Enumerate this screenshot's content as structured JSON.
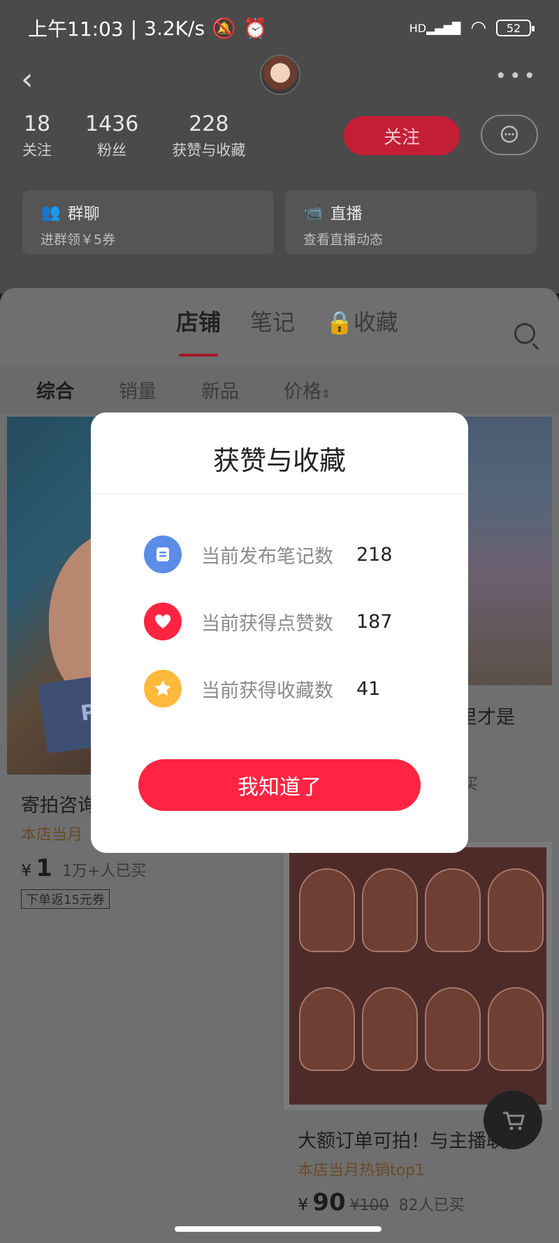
{
  "status_bar": {
    "time": "上午11:03",
    "speed": "3.2K/s",
    "battery": "52"
  },
  "profile": {
    "stats": [
      {
        "num": "18",
        "label": "关注"
      },
      {
        "num": "1436",
        "label": "粉丝"
      },
      {
        "num": "228",
        "label": "获赞与收藏"
      }
    ],
    "follow_label": "关注",
    "cards": [
      {
        "title": "群聊",
        "subtitle": "进群领￥5券",
        "icon": "group-icon"
      },
      {
        "title": "直播",
        "subtitle": "查看直播动态",
        "icon": "live-camera-icon"
      }
    ]
  },
  "tabs": [
    {
      "label": "店铺",
      "active": true
    },
    {
      "label": "笔记",
      "active": false
    },
    {
      "label": "收藏",
      "active": false,
      "icon": "lock-icon"
    }
  ],
  "filters": [
    {
      "label": "综合",
      "active": true
    },
    {
      "label": "销量",
      "active": false
    },
    {
      "label": "新品",
      "active": false
    },
    {
      "label": "价格",
      "active": false
    }
  ],
  "products": [
    {
      "title": "寄拍咨询",
      "tag": "本店当月",
      "price_symbol": "¥",
      "price": "1",
      "sold": "1万+人已买",
      "coupon": "下单返15元券"
    },
    {
      "title_tail": "里才是",
      "sold_tail": "买"
    },
    {
      "title": "大额订单可拍！与主播联",
      "tag": "本店当月热销top1",
      "price_symbol": "¥",
      "price": "90",
      "original_price": "¥100",
      "sold": "82人已买"
    }
  ],
  "modal": {
    "title": "获赞与收藏",
    "rows": [
      {
        "label": "当前发布笔记数",
        "value": "218",
        "icon": "note-icon",
        "color": "#5b8de8"
      },
      {
        "label": "当前获得点赞数",
        "value": "187",
        "icon": "heart-icon",
        "color": "#ff2442"
      },
      {
        "label": "当前获得收藏数",
        "value": "41",
        "icon": "star-icon",
        "color": "#ffb93b"
      }
    ],
    "button_label": "我知道了"
  },
  "colors": {
    "accent": "#ff2442",
    "overlay": "#000000"
  }
}
